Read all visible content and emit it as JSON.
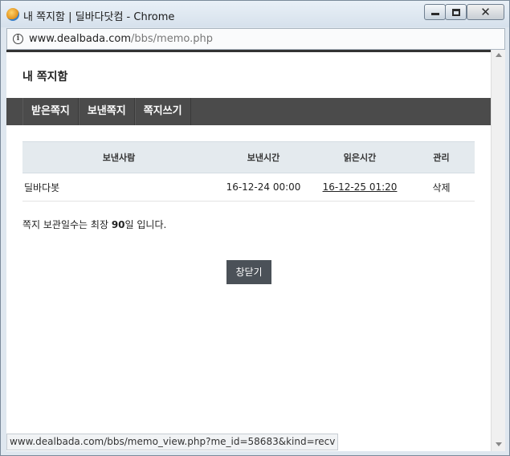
{
  "window": {
    "title": "내 쪽지함 | 딜바다닷컴 - Chrome",
    "minimize_label": "",
    "maximize_label": "",
    "close_glyph": "✕"
  },
  "address": {
    "host": "www.dealbada.com",
    "path": "/bbs/memo.php"
  },
  "page": {
    "title": "내 쪽지함",
    "tabs": [
      {
        "label": "받은쪽지"
      },
      {
        "label": "보낸쪽지"
      },
      {
        "label": "쪽지쓰기"
      }
    ],
    "table": {
      "headers": {
        "sender": "보낸사람",
        "sent_time": "보낸시간",
        "read_time": "읽은시간",
        "manage": "관리"
      },
      "rows": [
        {
          "sender": "딜바다봇",
          "sent_time": "16-12-24 00:00",
          "read_time": "16-12-25 01:20",
          "manage": "삭제"
        }
      ]
    },
    "note": {
      "prefix": "쪽지 보관일수는 최장 ",
      "days": "90",
      "suffix": "일 입니다."
    },
    "close_button": "창닫기"
  },
  "status_bar": {
    "url": "www.dealbada.com/bbs/memo_view.php?me_id=58683&kind=recv"
  }
}
